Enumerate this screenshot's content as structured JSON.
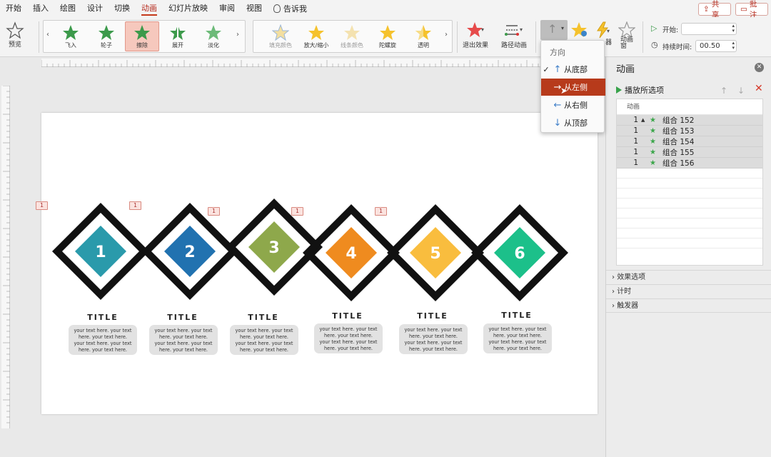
{
  "menubar": {
    "items": [
      "开始",
      "插入",
      "绘图",
      "设计",
      "切换",
      "动画",
      "幻灯片放映",
      "审阅",
      "视图"
    ],
    "active_index": 5,
    "tell_me": "告诉我",
    "share_label": "共享",
    "comment_label": "批注"
  },
  "ribbon": {
    "preview_label": "预览",
    "effects_enter": [
      "飞入",
      "轮子",
      "擦除",
      "展开",
      "淡化"
    ],
    "effects_emphasis": [
      "填充颜色",
      "放大/缩小",
      "线条颜色",
      "陀螺旋",
      "透明"
    ],
    "exit_label": "退出效果",
    "path_label": "路径动画",
    "pane_label": "动画\n窗",
    "extra_label": "器",
    "start_label": "开始:",
    "duration_label": "持续时间:",
    "duration_value": "00.50"
  },
  "dropdown": {
    "header": "方向",
    "items": [
      {
        "label": "从底部",
        "arrow": "↑",
        "checked": true
      },
      {
        "label": "从左侧",
        "arrow": "→",
        "checked": false
      },
      {
        "label": "从右侧",
        "arrow": "←",
        "checked": false
      },
      {
        "label": "从顶部",
        "arrow": "↓",
        "checked": false
      }
    ],
    "highlighted_index": 1
  },
  "slide": {
    "items": [
      {
        "number": "1",
        "color": "#2a9aab",
        "title": "TITLE",
        "text": "your text here. your text here. your text here. your text here. your text here. your text here."
      },
      {
        "number": "2",
        "color": "#2172b0",
        "title": "TITLE",
        "text": "your text here. your text here. your text here. your text here. your text here. your text here."
      },
      {
        "number": "3",
        "color": "#8ea84b",
        "title": "TITLE",
        "text": "your text here. your text here. your text here. your text here. your text here. your text here."
      },
      {
        "number": "4",
        "color": "#ef8b1f",
        "title": "TITLE",
        "text": "your text here. your text here. your text here. your text here. your text here. your text here."
      },
      {
        "number": "5",
        "color": "#f9bd3e",
        "title": "TITLE",
        "text": "your text here. your text here. your text here. your text here. your text here. your text here."
      },
      {
        "number": "6",
        "color": "#1cc08a",
        "title": "TITLE",
        "text": "your text here. your text here. your text here. your text here. your text here. your text here."
      }
    ],
    "tags": [
      "1",
      "1",
      "1",
      "1",
      "1"
    ]
  },
  "panel": {
    "title": "动画",
    "play_selected": "播放所选项",
    "list_header": "动画",
    "rows": [
      {
        "order": "1",
        "name": "组合 152"
      },
      {
        "order": "1",
        "name": "组合 153"
      },
      {
        "order": "1",
        "name": "组合 154"
      },
      {
        "order": "1",
        "name": "组合 155"
      },
      {
        "order": "1",
        "name": "组合 156"
      }
    ],
    "sections": [
      "效果选项",
      "计时",
      "触发器"
    ]
  },
  "colors": {
    "accent": "#b73a1b",
    "star_green": "#3ba64a"
  }
}
